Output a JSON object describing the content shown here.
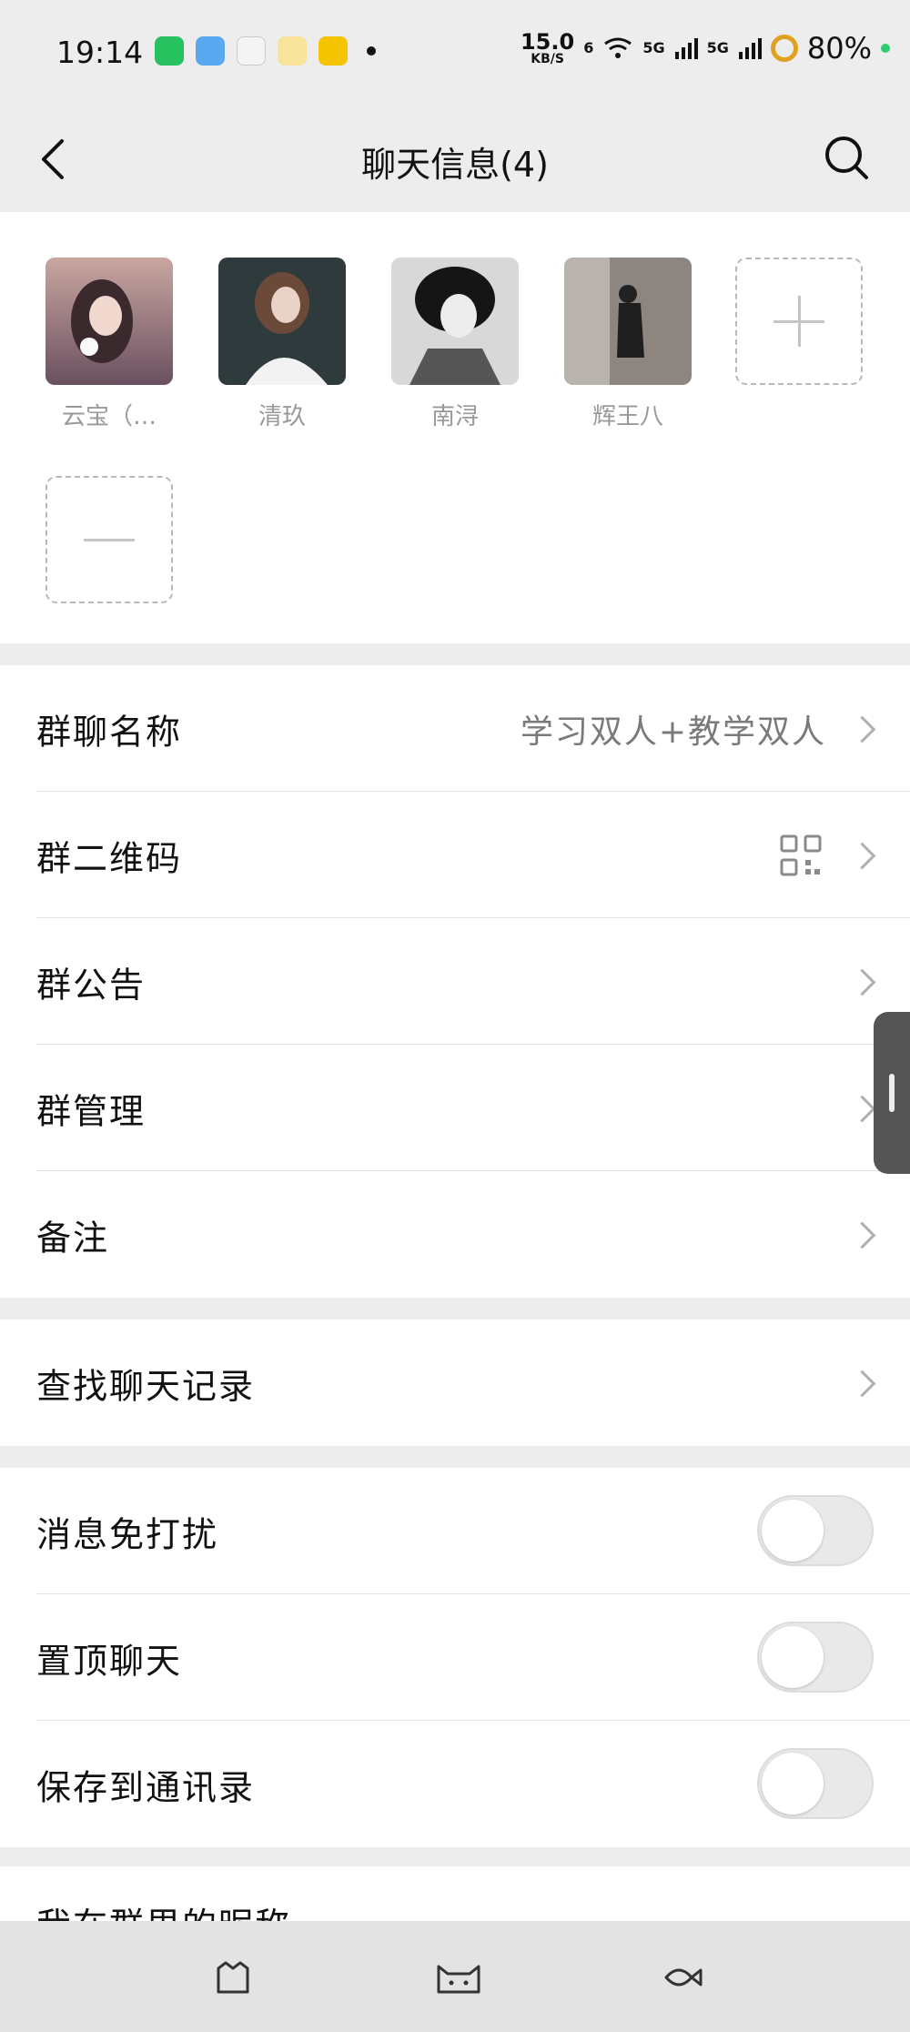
{
  "status_bar": {
    "time": "19:14",
    "net_speed_value": "15.0",
    "net_speed_unit": "KB/S",
    "signal_1": "5G",
    "signal_2": "5G",
    "hd": "6",
    "battery": "80%"
  },
  "header": {
    "title": "聊天信息(4)"
  },
  "members": [
    {
      "name": "云宝（…"
    },
    {
      "name": "清玖"
    },
    {
      "name": "南浔"
    },
    {
      "name": "辉王八"
    }
  ],
  "group_info": {
    "name_label": "群聊名称",
    "name_value": "学习双人+教学双人",
    "qr_label": "群二维码",
    "notice_label": "群公告",
    "manage_label": "群管理",
    "remark_label": "备注"
  },
  "search_history_label": "查找聊天记录",
  "toggles": {
    "mute_label": "消息免打扰",
    "pin_label": "置顶聊天",
    "save_label": "保存到通讯录",
    "mute_on": false,
    "pin_on": false,
    "save_on": false
  },
  "partial_row_label": "我在群里的昵称"
}
